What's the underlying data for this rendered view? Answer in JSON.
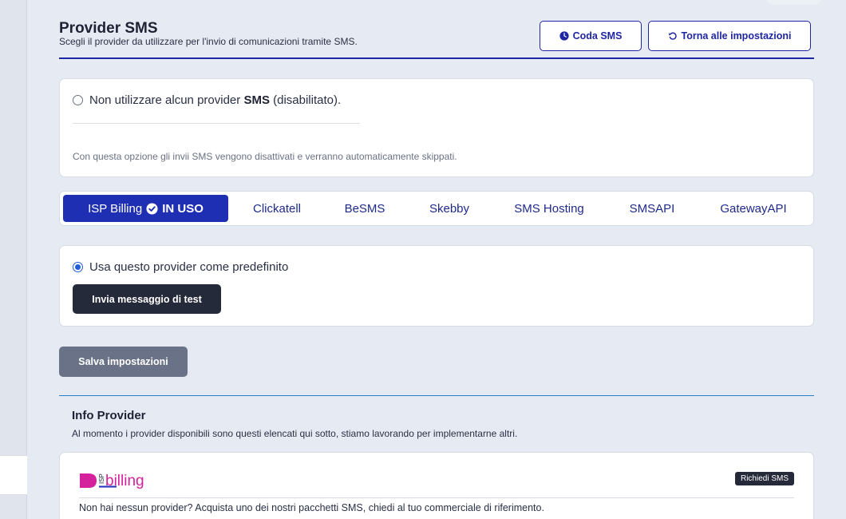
{
  "header": {
    "title": "Provider SMS",
    "subtitle": "Scegli il provider da utilizzare per l'invio di comunicazioni tramite SMS.",
    "queue_button": "Coda SMS",
    "back_button": "Torna alle impostazioni"
  },
  "disable_option": {
    "label_prefix": "Non utilizzare alcun provider ",
    "label_bold": "SMS",
    "label_suffix": " (disabilitato).",
    "help": "Con questa opzione gli invii SMS vengono disattivati e verranno automaticamente skippati.",
    "checked": false
  },
  "provider_tabs": {
    "active": {
      "label": "ISP Billing",
      "status": "IN USO"
    },
    "items": [
      "Clickatell",
      "BeSMS",
      "Skebby",
      "SMS Hosting",
      "SMSAPI",
      "GatewayAPI"
    ]
  },
  "provider_panel": {
    "default_label": "Usa questo provider come predefinito",
    "default_checked": true,
    "test_button": "Invia messaggio di test"
  },
  "save_button": "Salva impostazioni",
  "info": {
    "title": "Info Provider",
    "subtitle": "Al momento i provider disponibili sono questi elencati qui sotto, stiamo lavorando per implementarne altri.",
    "isp_card": {
      "logo_text": "billing",
      "logo_prefix": "ISP",
      "badge": "Richiedi SMS",
      "description": "Non hai nessun provider? Acquista uno dei nostri pacchetti SMS, chiedi al tuo commerciale di riferimento."
    }
  },
  "colors": {
    "accent": "#1f26a3",
    "tab_active": "#1e2fb4",
    "dark_button": "#252a3a",
    "save_button": "#6a7288",
    "background": "#e6eaf2",
    "logo_magenta": "#d6219c"
  }
}
